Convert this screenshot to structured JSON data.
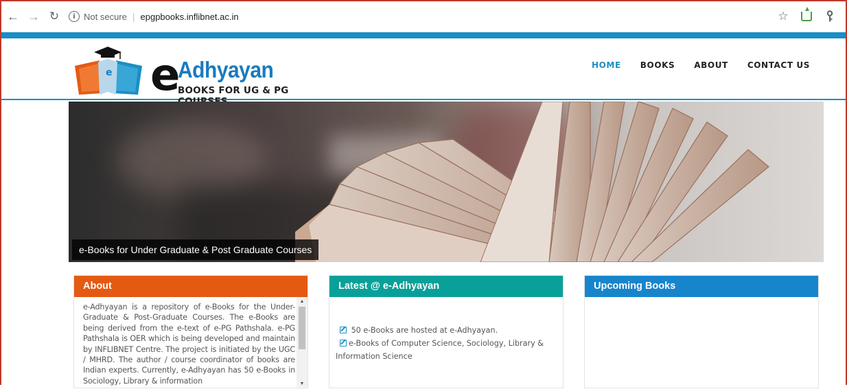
{
  "browser": {
    "security_label": "Not secure",
    "separator": "|",
    "url": "epgpbooks.inflibnet.ac.in",
    "icons": [
      "back-arrow-icon",
      "forward-arrow-icon",
      "reload-icon",
      "info-icon",
      "star-icon",
      "extension-icon",
      "key-icon"
    ]
  },
  "site": {
    "logo": {
      "letter": "e",
      "name": "Adhyayan",
      "tagline": "BOOKS FOR UG & PG COURSES"
    },
    "nav": [
      {
        "label": "HOME",
        "active": true
      },
      {
        "label": "BOOKS",
        "active": false
      },
      {
        "label": "ABOUT",
        "active": false
      },
      {
        "label": "CONTACT US",
        "active": false
      }
    ],
    "hero": {
      "caption": "e-Books for Under Graduate & Post Graduate Courses"
    },
    "panels": {
      "about": {
        "title": "About",
        "text": "e-Adhyayan is a repository of e-Books for the Under-Graduate & Post-Graduate Courses. The e-Books are being derived from the e-text of e-PG Pathshala. e-PG Pathshala is OER which is being developed and maintain by INFLIBNET Centre. The project is initiated by the UGC / MHRD. The author / course coordinator of books are Indian experts. Currently, e-Adhyayan has 50 e-Books in Sociology, Library & information"
      },
      "latest": {
        "title": "Latest @ e-Adhyayan",
        "items": [
          "50 e-Books are hosted at e-Adhyayan.",
          "e-Books of Computer Science, Sociology, Library & Information Science"
        ]
      },
      "upcoming": {
        "title": "Upcoming Books"
      }
    }
  },
  "colors": {
    "accent_blue": "#1a8fc4",
    "about_orange": "#e45a13",
    "latest_teal": "#0aa09a",
    "upcoming_blue": "#1785cc"
  }
}
